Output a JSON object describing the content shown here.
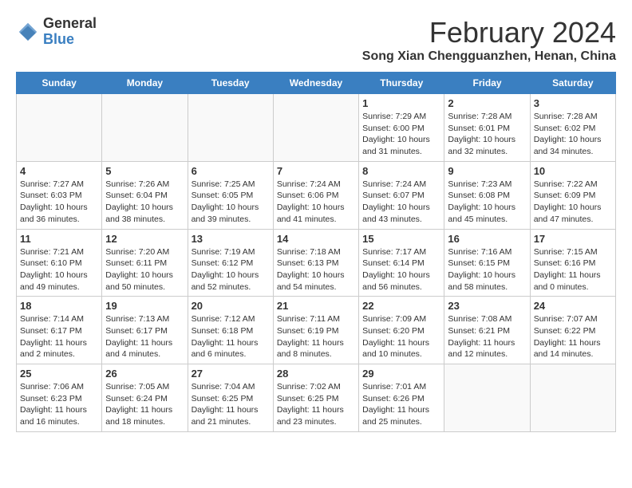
{
  "logo": {
    "line1": "General",
    "line2": "Blue"
  },
  "title": "February 2024",
  "location": "Song Xian Chengguanzhen, Henan, China",
  "days_of_week": [
    "Sunday",
    "Monday",
    "Tuesday",
    "Wednesday",
    "Thursday",
    "Friday",
    "Saturday"
  ],
  "weeks": [
    [
      {
        "day": "",
        "info": ""
      },
      {
        "day": "",
        "info": ""
      },
      {
        "day": "",
        "info": ""
      },
      {
        "day": "",
        "info": ""
      },
      {
        "day": "1",
        "info": "Sunrise: 7:29 AM\nSunset: 6:00 PM\nDaylight: 10 hours\nand 31 minutes."
      },
      {
        "day": "2",
        "info": "Sunrise: 7:28 AM\nSunset: 6:01 PM\nDaylight: 10 hours\nand 32 minutes."
      },
      {
        "day": "3",
        "info": "Sunrise: 7:28 AM\nSunset: 6:02 PM\nDaylight: 10 hours\nand 34 minutes."
      }
    ],
    [
      {
        "day": "4",
        "info": "Sunrise: 7:27 AM\nSunset: 6:03 PM\nDaylight: 10 hours\nand 36 minutes."
      },
      {
        "day": "5",
        "info": "Sunrise: 7:26 AM\nSunset: 6:04 PM\nDaylight: 10 hours\nand 38 minutes."
      },
      {
        "day": "6",
        "info": "Sunrise: 7:25 AM\nSunset: 6:05 PM\nDaylight: 10 hours\nand 39 minutes."
      },
      {
        "day": "7",
        "info": "Sunrise: 7:24 AM\nSunset: 6:06 PM\nDaylight: 10 hours\nand 41 minutes."
      },
      {
        "day": "8",
        "info": "Sunrise: 7:24 AM\nSunset: 6:07 PM\nDaylight: 10 hours\nand 43 minutes."
      },
      {
        "day": "9",
        "info": "Sunrise: 7:23 AM\nSunset: 6:08 PM\nDaylight: 10 hours\nand 45 minutes."
      },
      {
        "day": "10",
        "info": "Sunrise: 7:22 AM\nSunset: 6:09 PM\nDaylight: 10 hours\nand 47 minutes."
      }
    ],
    [
      {
        "day": "11",
        "info": "Sunrise: 7:21 AM\nSunset: 6:10 PM\nDaylight: 10 hours\nand 49 minutes."
      },
      {
        "day": "12",
        "info": "Sunrise: 7:20 AM\nSunset: 6:11 PM\nDaylight: 10 hours\nand 50 minutes."
      },
      {
        "day": "13",
        "info": "Sunrise: 7:19 AM\nSunset: 6:12 PM\nDaylight: 10 hours\nand 52 minutes."
      },
      {
        "day": "14",
        "info": "Sunrise: 7:18 AM\nSunset: 6:13 PM\nDaylight: 10 hours\nand 54 minutes."
      },
      {
        "day": "15",
        "info": "Sunrise: 7:17 AM\nSunset: 6:14 PM\nDaylight: 10 hours\nand 56 minutes."
      },
      {
        "day": "16",
        "info": "Sunrise: 7:16 AM\nSunset: 6:15 PM\nDaylight: 10 hours\nand 58 minutes."
      },
      {
        "day": "17",
        "info": "Sunrise: 7:15 AM\nSunset: 6:16 PM\nDaylight: 11 hours\nand 0 minutes."
      }
    ],
    [
      {
        "day": "18",
        "info": "Sunrise: 7:14 AM\nSunset: 6:17 PM\nDaylight: 11 hours\nand 2 minutes."
      },
      {
        "day": "19",
        "info": "Sunrise: 7:13 AM\nSunset: 6:17 PM\nDaylight: 11 hours\nand 4 minutes."
      },
      {
        "day": "20",
        "info": "Sunrise: 7:12 AM\nSunset: 6:18 PM\nDaylight: 11 hours\nand 6 minutes."
      },
      {
        "day": "21",
        "info": "Sunrise: 7:11 AM\nSunset: 6:19 PM\nDaylight: 11 hours\nand 8 minutes."
      },
      {
        "day": "22",
        "info": "Sunrise: 7:09 AM\nSunset: 6:20 PM\nDaylight: 11 hours\nand 10 minutes."
      },
      {
        "day": "23",
        "info": "Sunrise: 7:08 AM\nSunset: 6:21 PM\nDaylight: 11 hours\nand 12 minutes."
      },
      {
        "day": "24",
        "info": "Sunrise: 7:07 AM\nSunset: 6:22 PM\nDaylight: 11 hours\nand 14 minutes."
      }
    ],
    [
      {
        "day": "25",
        "info": "Sunrise: 7:06 AM\nSunset: 6:23 PM\nDaylight: 11 hours\nand 16 minutes."
      },
      {
        "day": "26",
        "info": "Sunrise: 7:05 AM\nSunset: 6:24 PM\nDaylight: 11 hours\nand 18 minutes."
      },
      {
        "day": "27",
        "info": "Sunrise: 7:04 AM\nSunset: 6:25 PM\nDaylight: 11 hours\nand 21 minutes."
      },
      {
        "day": "28",
        "info": "Sunrise: 7:02 AM\nSunset: 6:25 PM\nDaylight: 11 hours\nand 23 minutes."
      },
      {
        "day": "29",
        "info": "Sunrise: 7:01 AM\nSunset: 6:26 PM\nDaylight: 11 hours\nand 25 minutes."
      },
      {
        "day": "",
        "info": ""
      },
      {
        "day": "",
        "info": ""
      }
    ]
  ]
}
